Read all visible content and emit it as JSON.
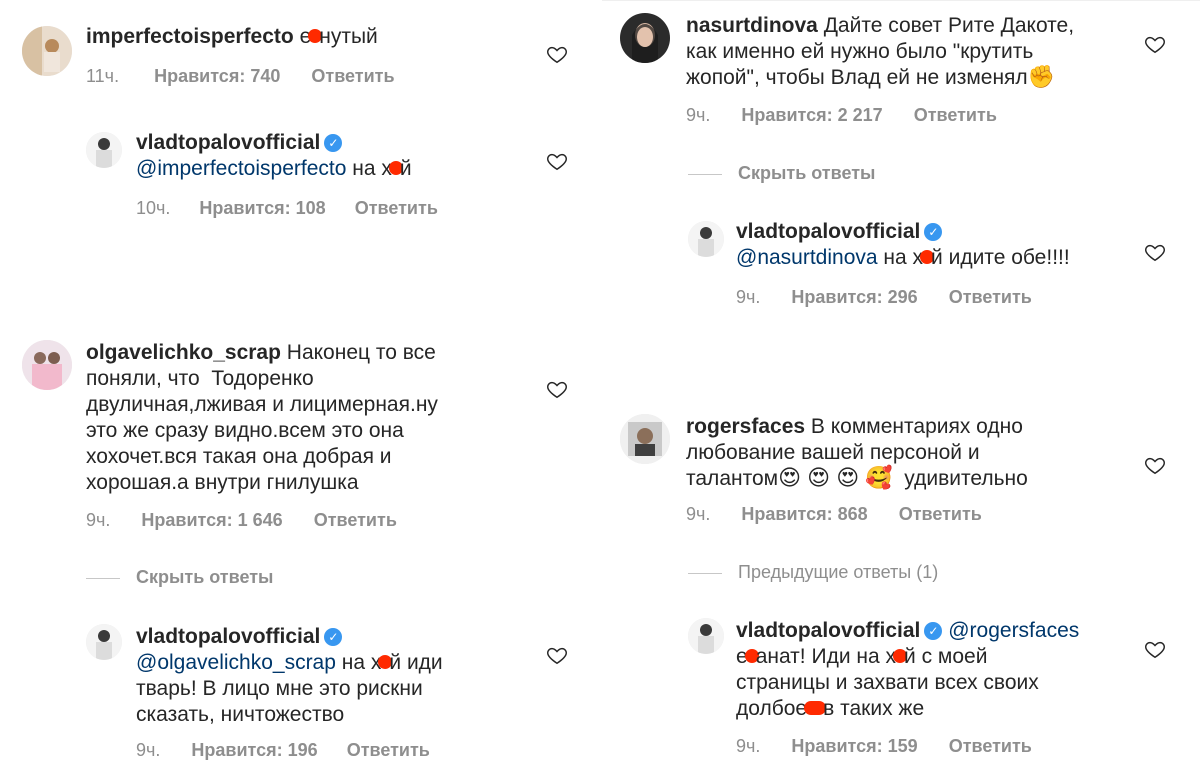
{
  "colors": {
    "text": "#262626",
    "meta": "#8e8e8e",
    "mention": "#00376b",
    "verified": "#3897f0",
    "censor": "#ff2a00"
  },
  "left_top": {
    "comment": {
      "user": "imperfectoisperfecto",
      "text_before": " е",
      "text_after": "нутый",
      "time": "11ч.",
      "likes": "Нравится: 740",
      "reply": "Ответить"
    },
    "reply": {
      "user": "vladtopalovofficial",
      "mention": "@imperfectoisperfecto",
      "text_before": " на х",
      "text_after": "й",
      "time": "10ч.",
      "likes": "Нравится: 108",
      "reply": "Ответить"
    }
  },
  "left_bottom": {
    "comment": {
      "user": "olgavelichko_scrap",
      "line1": " Наконец то все",
      "line2": "поняли, что  Тодоренко",
      "line3": "двуличная,лживая и лицимерная.ну",
      "line4": "это же сразу видно.всем это она",
      "line5": "хохочет.вся такая она добрая и",
      "line6": "хорошая.а внутри гнилушка",
      "time": "9ч.",
      "likes": "Нравится: 1 646",
      "reply": "Ответить"
    },
    "toggle": "Скрыть ответы",
    "reply": {
      "user": "vladtopalovofficial",
      "mention": "@olgavelichko_scrap",
      "text_before": " на х",
      "text_after": "й иди",
      "line2": "тварь! В лицо мне это рискни",
      "line3": "сказать, ничтожество",
      "time": "9ч.",
      "likes": "Нравится: 196",
      "reply": "Ответить"
    }
  },
  "right_top": {
    "comment": {
      "user": "nasurtdinova",
      "line1": " Дайте совет Рите Дакоте,",
      "line2": "как именно ей нужно было \"крутить",
      "line3": "жопой\", чтобы Влад ей не изменял",
      "emoji": "✊",
      "time": "9ч.",
      "likes": "Нравится: 2 217",
      "reply": "Ответить"
    },
    "toggle": "Скрыть ответы",
    "reply": {
      "user": "vladtopalovofficial",
      "mention": "@nasurtdinova",
      "text_before": " на х",
      "text_after": "й идите обе!!!!",
      "time": "9ч.",
      "likes": "Нравится: 296",
      "reply": "Ответить"
    }
  },
  "right_bottom": {
    "comment": {
      "user": "rogersfaces",
      "line1": " В комментариях одно",
      "line2": "любование вашей персоной и",
      "line3_prefix": "талантом",
      "emojis": "😍 😍 😍 🥰",
      "line3_suffix": "  удивительно",
      "time": "9ч.",
      "likes": "Нравится: 868",
      "reply": "Ответить"
    },
    "toggle": "Предыдущие ответы (1)",
    "reply": {
      "user": "vladtopalovofficial",
      "mention": "@rogersfaces",
      "line1_before": "е",
      "line1_mid": "анат! Иди на х",
      "line1_after": "й с моей",
      "line2": "страницы и захвати всех своих",
      "line3_before": "долбое",
      "line3_after": "в таких же",
      "time": "9ч.",
      "likes": "Нравится: 159",
      "reply": "Ответить"
    }
  }
}
